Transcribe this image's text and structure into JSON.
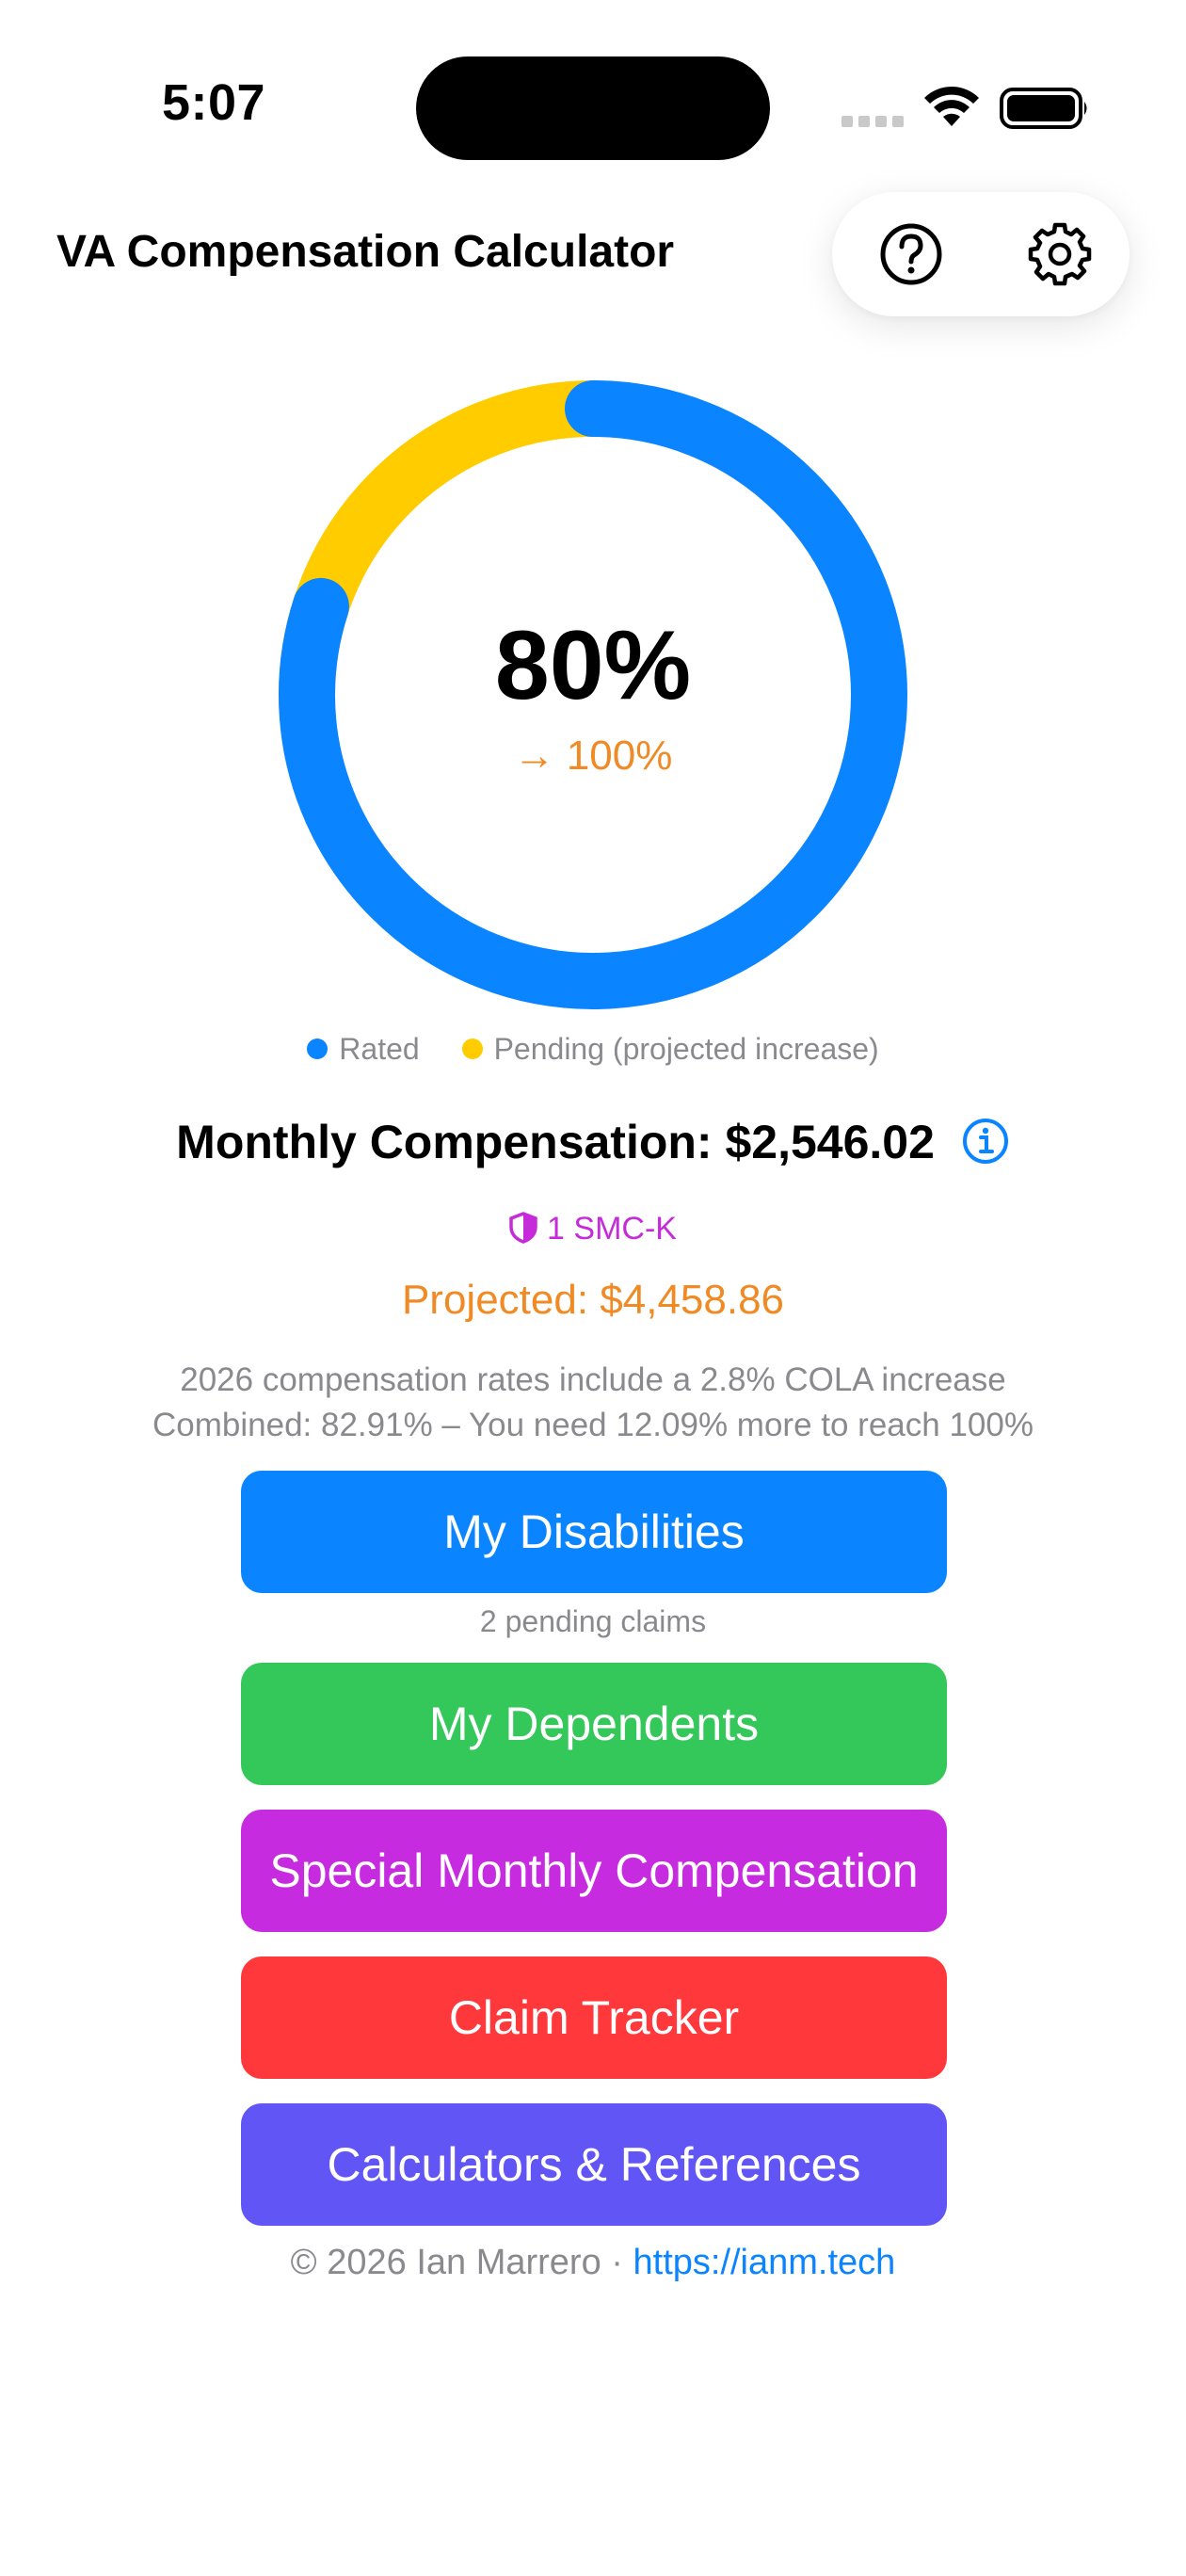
{
  "status_bar": {
    "time": "5:07"
  },
  "header": {
    "title": "VA Compensation Calculator",
    "help_icon": "question-circle-icon",
    "settings_icon": "gear-icon"
  },
  "rating": {
    "current": "80%",
    "projected": "→ 100%",
    "current_fraction": 0.8,
    "pending_fraction": 0.2,
    "colors": {
      "rated": "#0a84ff",
      "pending": "#ffcc00"
    }
  },
  "legend": {
    "rated": "Rated",
    "pending": "Pending (projected increase)"
  },
  "compensation": {
    "monthly": "Monthly Compensation: $2,546.02",
    "smc": "1 SMC-K",
    "projected": "Projected: $4,458.86",
    "cola_note": "2026 compensation rates include a 2.8% COLA increase",
    "combined_note": "Combined: 82.91% – You need 12.09% more to reach 100%"
  },
  "buttons": {
    "disabilities": "My Disabilities",
    "pending_claims": "2 pending claims",
    "dependents": "My Dependents",
    "smc": "Special Monthly Compensation",
    "claim_tracker": "Claim Tracker",
    "calculators": "Calculators & References"
  },
  "footer": {
    "copyright": "© 2026 Ian Marrero · ",
    "link": "https://ianm.tech"
  }
}
